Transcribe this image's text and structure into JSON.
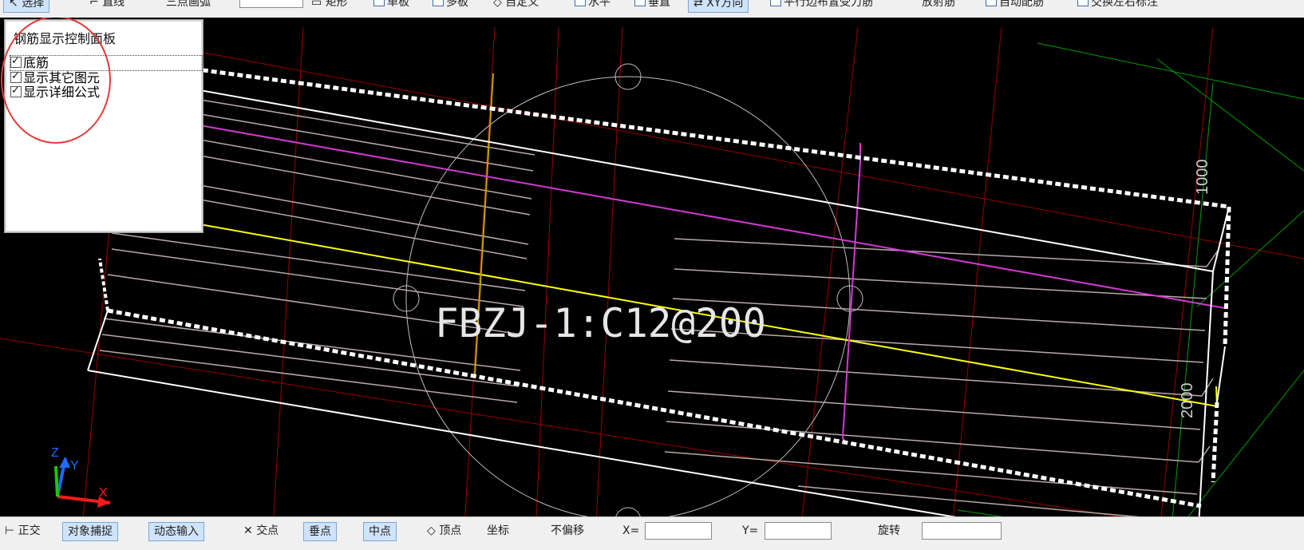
{
  "toolbar_top": {
    "items": [
      "选择",
      "直线",
      "三点画弧",
      "矩形",
      "单板",
      "多板",
      "自定义",
      "水平",
      "垂直",
      "XY方向",
      "平行边布置受力筋",
      "放射筋",
      "自动配筋",
      "交换左右标注"
    ]
  },
  "control_panel": {
    "title": "钢筋显示控制面板",
    "options": [
      {
        "label": "底筋",
        "checked": true
      },
      {
        "label": "显示其它图元",
        "checked": true
      },
      {
        "label": "显示详细公式",
        "checked": true
      }
    ]
  },
  "canvas": {
    "rebar_label": "FBZJ-1:C12@200",
    "dim_top": "1000",
    "dim_bottom": "2000",
    "axis_labels": {
      "x": "X",
      "y": "Y",
      "z": "Z"
    },
    "colors": {
      "background": "#000000",
      "slab_outline": "#ffffff",
      "rebar_gray": "#b7aaa6",
      "rebar_yellow": "#ffff00",
      "rebar_magenta": "#d23ad2",
      "grid_red": "#9b0000",
      "grid_green": "#00a000",
      "label_circle": "#bfbfbf",
      "highlight_circle": "#e23b3b"
    }
  },
  "toolbar_bottom": {
    "items": [
      "正交",
      "对象捕捉",
      "动态输入",
      "交点",
      "垂点",
      "中点",
      "顶点",
      "坐标",
      "不偏移",
      "X=",
      "Y=",
      "旋转"
    ]
  }
}
